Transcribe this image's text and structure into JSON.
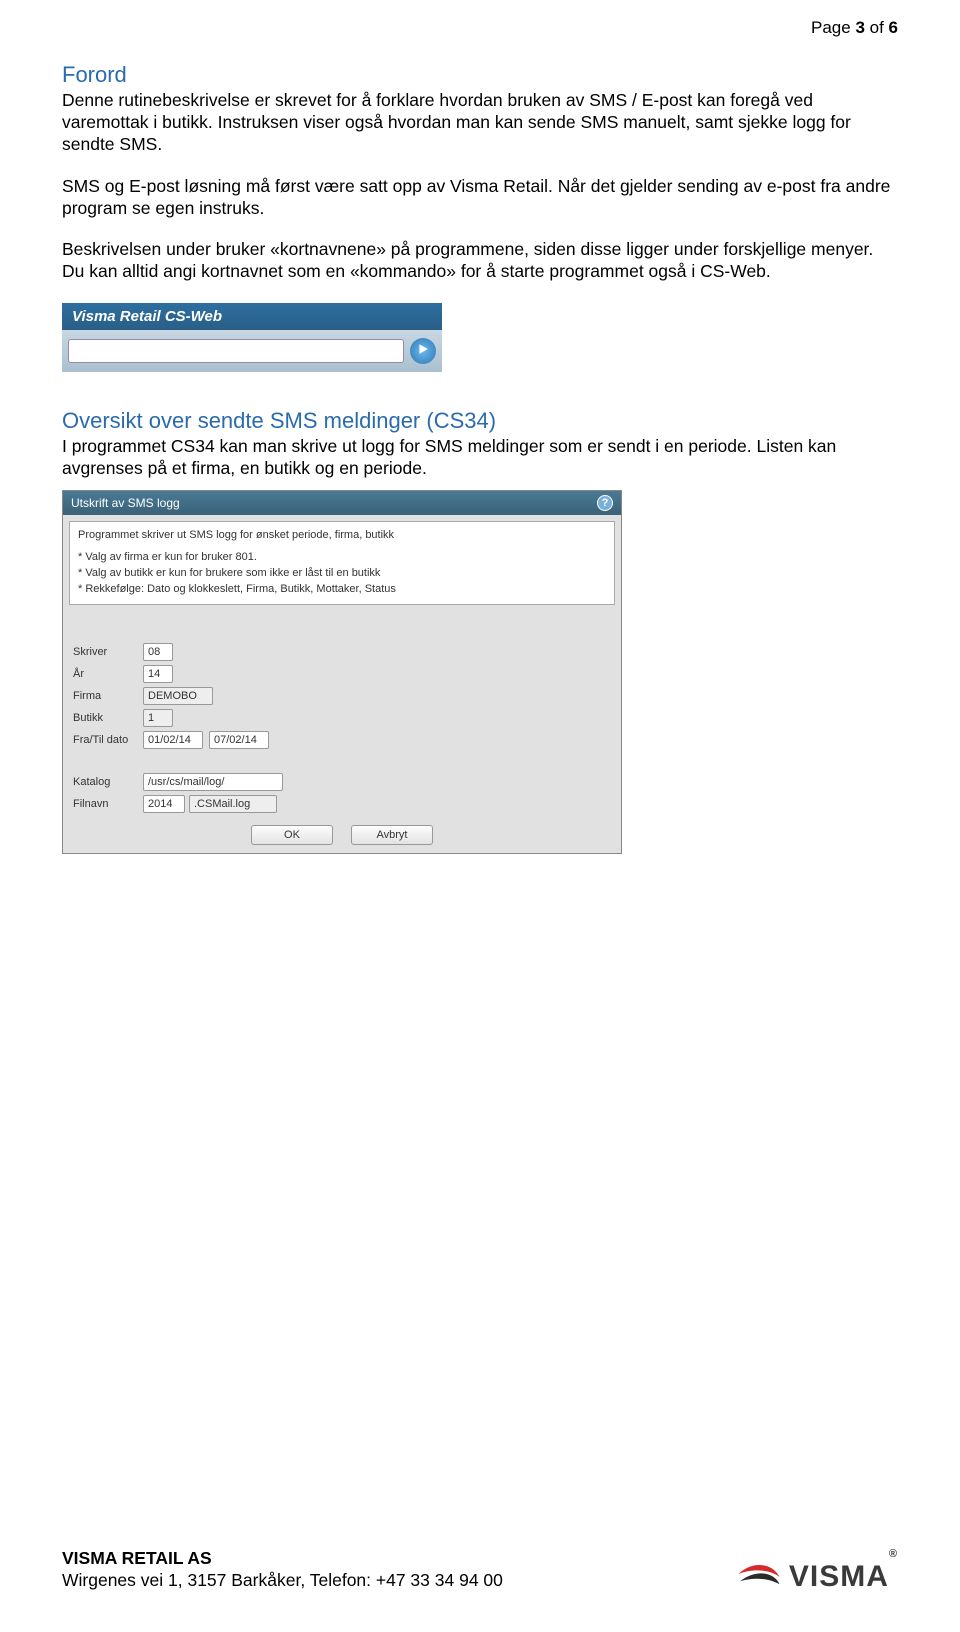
{
  "pageHeader": {
    "prefix": "Page ",
    "n": "3",
    "mid": " of ",
    "total": "6"
  },
  "forord": {
    "title": "Forord",
    "p1": "Denne rutinebeskrivelse er skrevet for å forklare hvordan bruken av SMS / E-post kan foregå ved varemottak i butikk. Instruksen viser også hvordan man kan sende SMS manuelt, samt sjekke logg for sendte SMS.",
    "p2": "SMS og E-post løsning må først være satt opp av Visma Retail. Når det gjelder sending av e-post fra andre program se egen instruks.",
    "p3": "Beskrivelsen under bruker «kortnavnene» på programmene, siden disse ligger under forskjellige menyer. Du kan alltid angi kortnavnet som en «kommando» for å starte programmet også i CS-Web."
  },
  "csweb": {
    "title": "Visma Retail CS-Web"
  },
  "oversikt": {
    "title": "Oversikt over sendte SMS meldinger (CS34)",
    "p": "I programmet CS34 kan man skrive ut logg for SMS meldinger som er sendt i en periode. Listen kan avgrenses på et firma, en butikk og en periode."
  },
  "form": {
    "title": "Utskrift av SMS logg",
    "info_lead": "Programmet skriver ut SMS logg for ønsket periode, firma, butikk",
    "info_b1": "* Valg av firma er kun for bruker 801.",
    "info_b2": "* Valg av butikk er kun for brukere som ikke er låst til en butikk",
    "info_b3": "* Rekkefølge: Dato og klokkeslett, Firma, Butikk, Mottaker, Status",
    "labels": {
      "skriver": "Skriver",
      "aar": "År",
      "firma": "Firma",
      "butikk": "Butikk",
      "fratil": "Fra/Til dato",
      "katalog": "Katalog",
      "filnavn": "Filnavn"
    },
    "values": {
      "skriver": "08",
      "aar": "14",
      "firma": "DEMOBO",
      "butikk": "1",
      "fra": "01/02/14",
      "til": "07/02/14",
      "katalog": "/usr/cs/mail/log/",
      "filnavn_prefix": "2014",
      "filnavn_ext": ".CSMail.log"
    },
    "ok": "OK",
    "avbryt": "Avbryt"
  },
  "footer": {
    "company": "VISMA RETAIL AS",
    "addr": "Wirgenes vei 1, 3157 Barkåker, Telefon: +47 33 34 94 00",
    "logo": "VISMA"
  }
}
